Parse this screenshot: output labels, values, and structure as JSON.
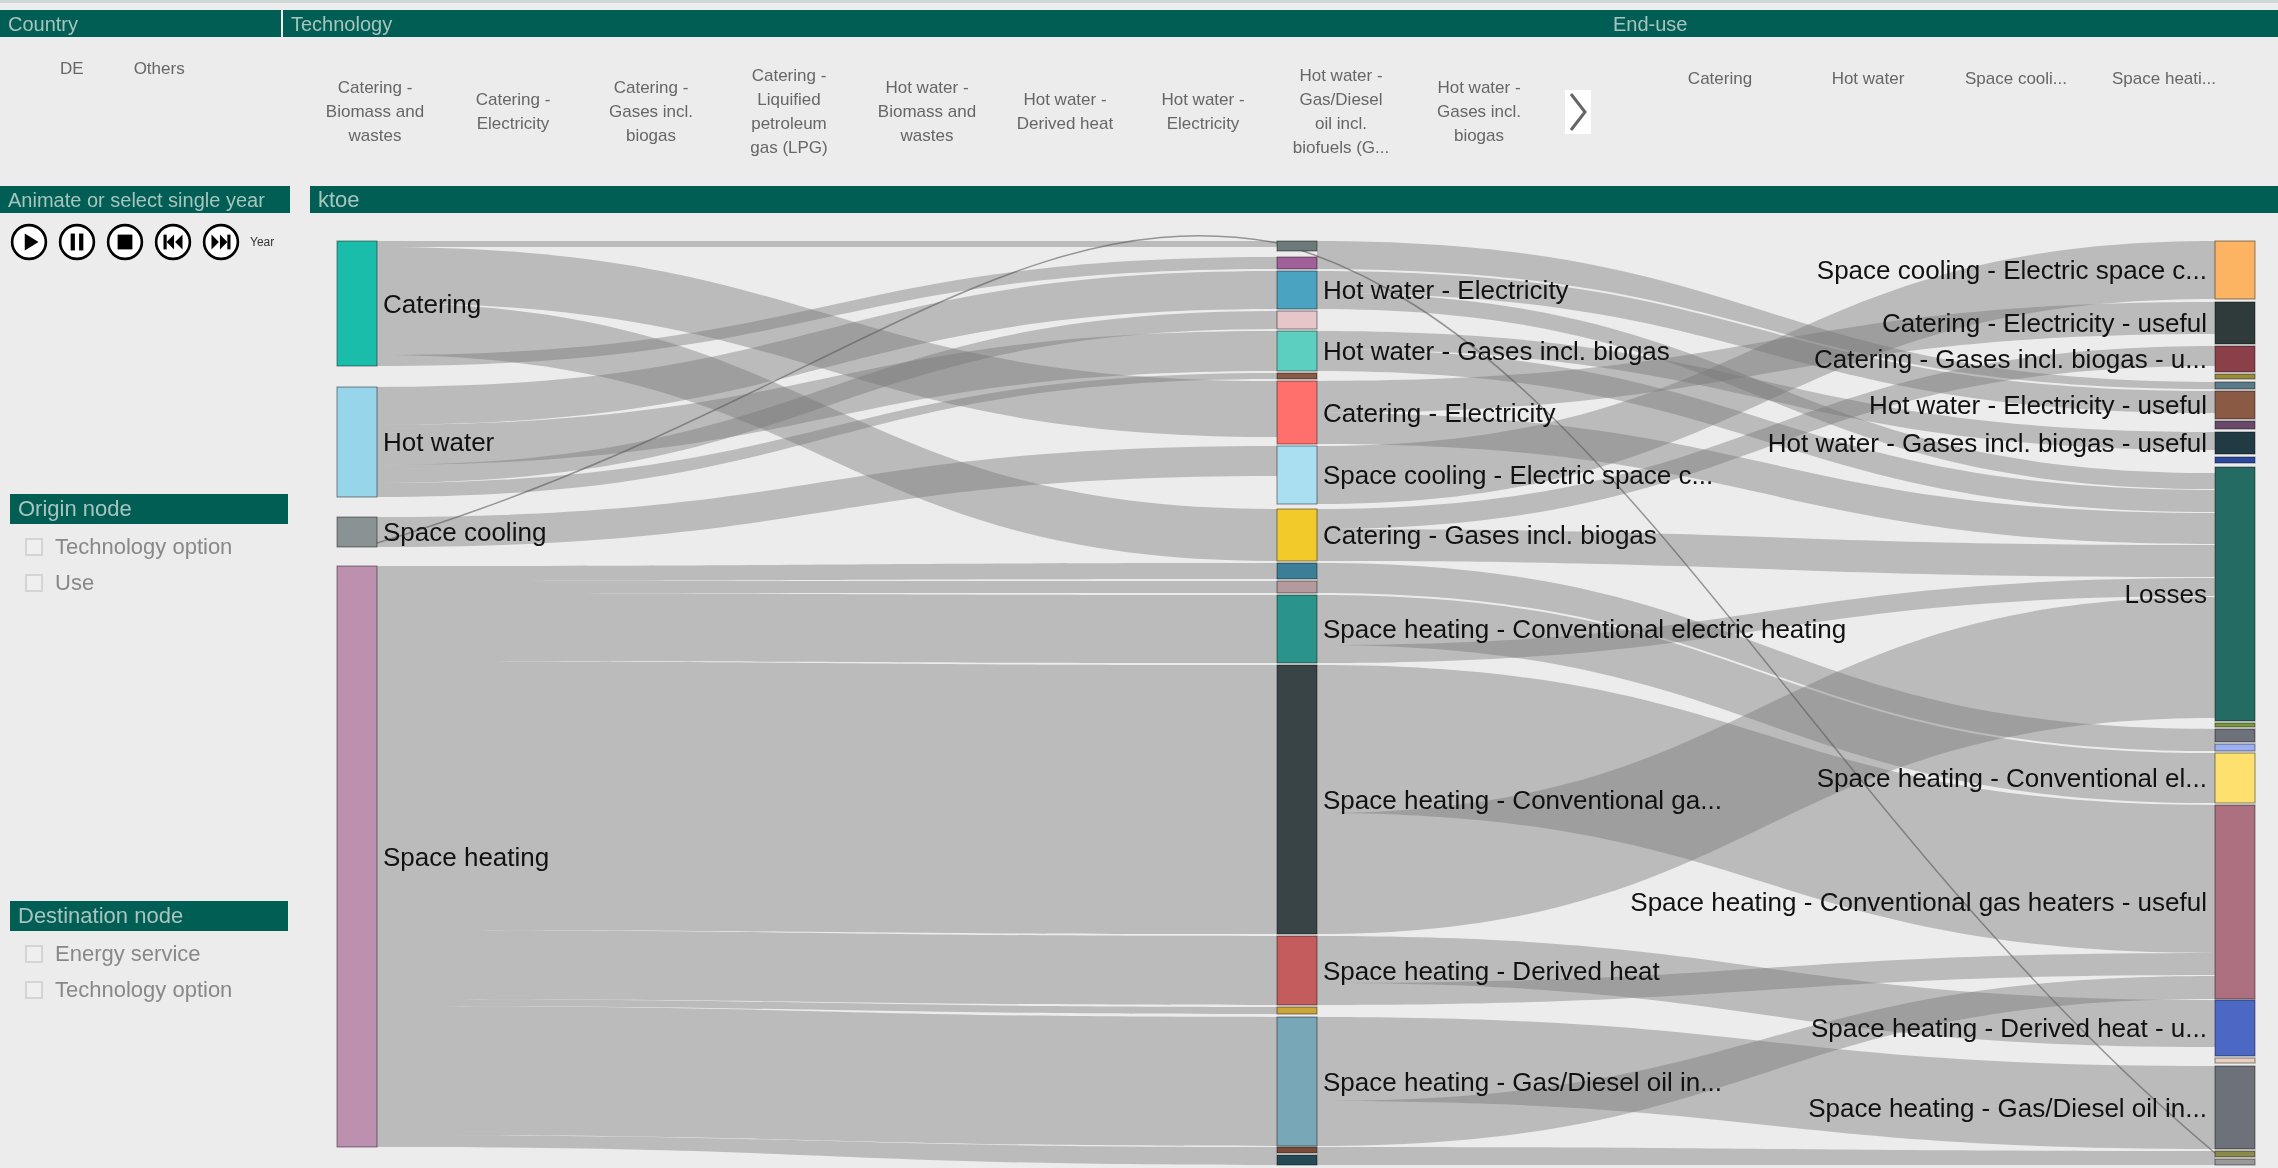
{
  "country": {
    "title": "Country",
    "items": [
      {
        "label": "DE"
      },
      {
        "label": "Others"
      }
    ]
  },
  "technology": {
    "title": "Technology",
    "items": [
      {
        "label": "Catering - Biomass and wastes"
      },
      {
        "label": "Catering - Electricity"
      },
      {
        "label": "Catering - Gases incl. biogas"
      },
      {
        "label": "Catering - Liquified petroleum gas (LPG)"
      },
      {
        "label": "Hot water - Biomass and wastes"
      },
      {
        "label": "Hot water - Derived heat"
      },
      {
        "label": "Hot water - Electricity"
      },
      {
        "label": "Hot water - Gas/Diesel oil incl. biofuels (G..."
      },
      {
        "label": "Hot water - Gases incl. biogas"
      }
    ]
  },
  "end_use": {
    "title": "End-use",
    "items": [
      {
        "label": "Catering"
      },
      {
        "label": "Hot water"
      },
      {
        "label": "Space cooli..."
      },
      {
        "label": "Space heati..."
      }
    ]
  },
  "animation": {
    "title": "Animate or select single year",
    "year_label": "Year"
  },
  "origin_node": {
    "title": "Origin node",
    "options": [
      {
        "label": "Technology option",
        "checked": false
      },
      {
        "label": "Use",
        "checked": false
      }
    ]
  },
  "destination_node": {
    "title": "Destination node",
    "options": [
      {
        "label": "Energy service",
        "checked": false
      },
      {
        "label": "Technology option",
        "checked": false
      }
    ]
  },
  "sankey": {
    "unit": "ktoe",
    "origin_nodes": [
      {
        "label": "Catering",
        "color": "#1abcaa"
      },
      {
        "label": "Hot water",
        "color": "#97d5ea"
      },
      {
        "label": "Space cooling",
        "color": "#8a9393"
      },
      {
        "label": "Space heating",
        "color": "#bd90b0"
      }
    ],
    "technology_nodes": [
      {
        "color": "#6c7a7a"
      },
      {
        "color": "#a0609a"
      },
      {
        "label": "Hot water - Electricity",
        "color": "#4aa3c0"
      },
      {
        "color": "#e7c6c9"
      },
      {
        "label": "Hot water - Gases incl. biogas",
        "color": "#5ccfc0"
      },
      {
        "color": "#8b5a44"
      },
      {
        "label": "Catering - Electricity",
        "color": "#ff6f6b"
      },
      {
        "label": "Space cooling - Electric space c...",
        "color": "#a9dff0"
      },
      {
        "label": "Catering - Gases incl. biogas",
        "color": "#f2cb2a"
      },
      {
        "color": "#3a7f95"
      },
      {
        "color": "#b49a9c"
      },
      {
        "label": "Space heating - Conventional electric heating",
        "color": "#2a948a"
      },
      {
        "label": "Space heating - Conventional ga...",
        "color": "#384446"
      },
      {
        "label": "Space heating - Derived heat",
        "color": "#c45b5c"
      },
      {
        "color": "#c9a53a"
      },
      {
        "label": "Space heating - Gas/Diesel oil in...",
        "color": "#78a8b8"
      },
      {
        "color": "#7a4a3a"
      },
      {
        "color": "#234a55"
      }
    ],
    "end_use_nodes": [
      {
        "label": "Space cooling - Electric space c...",
        "color": "#fdb462"
      },
      {
        "label": "Catering - Electricity - useful",
        "color": "#2f3a3a"
      },
      {
        "label": "Catering - Gases incl. biogas - u...",
        "color": "#8b4049"
      },
      {
        "color": "#9a8a3a"
      },
      {
        "color": "#5a7a8a"
      },
      {
        "label": "Hot water - Electricity - useful",
        "color": "#8b5a44"
      },
      {
        "color": "#6a4a6a"
      },
      {
        "label": "Hot water - Gases incl. biogas - useful",
        "color": "#213b44"
      },
      {
        "color": "#2a4aa0"
      },
      {
        "label": "Losses",
        "color": "#246b63"
      },
      {
        "color": "#7a9a3a"
      },
      {
        "color": "#6c717a"
      },
      {
        "color": "#9ab0f0"
      },
      {
        "label": "Space heating - Conventional el...",
        "color": "#fde06d"
      },
      {
        "label": "Space heating - Conventional gas heaters - useful",
        "color": "#ad7080"
      },
      {
        "label": "Space heating - Derived heat - u...",
        "color": "#4a68c4"
      },
      {
        "color": "#e8d0c0"
      },
      {
        "label": "Space heating - Gas/Diesel oil in...",
        "color": "#6c717a"
      },
      {
        "color": "#8a8a4a"
      },
      {
        "color": "#9a9a9a"
      }
    ]
  }
}
